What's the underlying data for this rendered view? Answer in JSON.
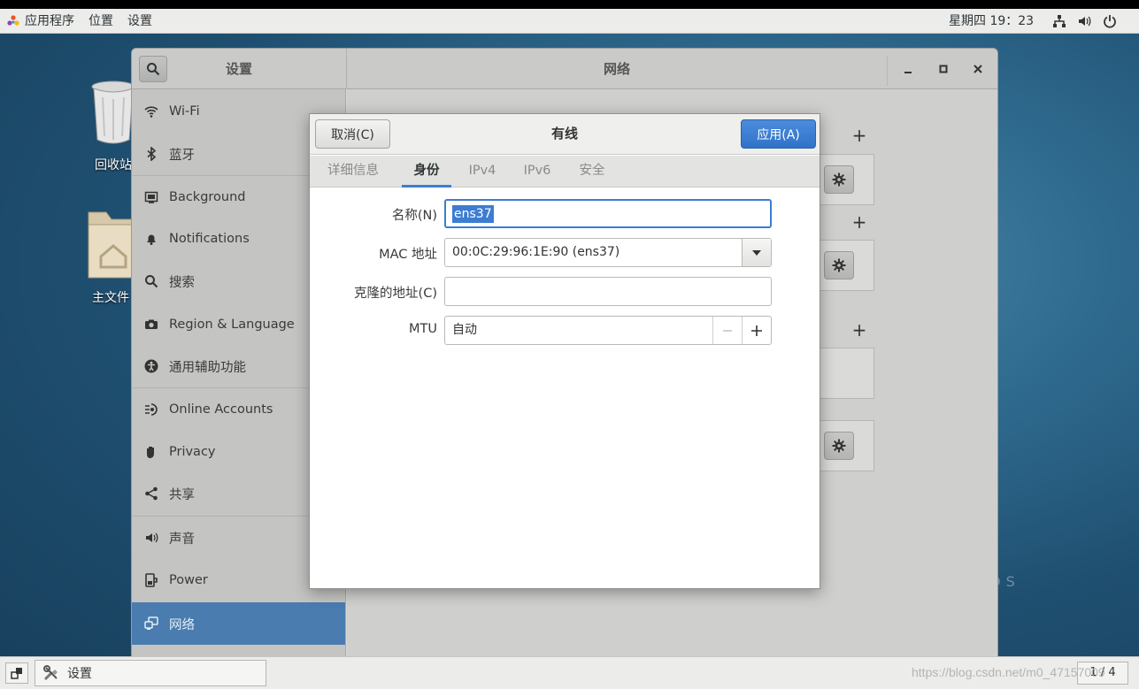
{
  "top_panel": {
    "menus": [
      "应用程序",
      "位置",
      "设置"
    ],
    "clock": "星期四 19：23",
    "tray": [
      "network-icon",
      "volume-icon",
      "power-icon"
    ]
  },
  "desktop": {
    "icons": [
      {
        "label": "回收站",
        "icon": "trash-icon"
      },
      {
        "label": "主文件",
        "icon": "home-folder-icon"
      }
    ],
    "brand_text": "OS"
  },
  "settings": {
    "sidebar_title": "设置",
    "main_title": "网络",
    "sidebar_items": [
      {
        "label": "Wi-Fi",
        "icon": "wifi-icon"
      },
      {
        "label": "蓝牙",
        "icon": "bluetooth-icon"
      },
      {
        "label": "Background",
        "icon": "background-icon"
      },
      {
        "label": "Notifications",
        "icon": "bell-icon"
      },
      {
        "label": "搜索",
        "icon": "search-icon"
      },
      {
        "label": "Region & Language",
        "icon": "camera-icon"
      },
      {
        "label": "通用辅助功能",
        "icon": "accessibility-icon"
      },
      {
        "label": "Online Accounts",
        "icon": "online-accounts-icon"
      },
      {
        "label": "Privacy",
        "icon": "hand-icon"
      },
      {
        "label": "共享",
        "icon": "share-icon"
      },
      {
        "label": "声音",
        "icon": "sound-icon"
      },
      {
        "label": "Power",
        "icon": "power-plug-icon"
      },
      {
        "label": "网络",
        "icon": "network-icon",
        "selected": true
      }
    ]
  },
  "dialog": {
    "title": "有线",
    "cancel_label": "取消(C)",
    "apply_label": "应用(A)",
    "tabs": [
      {
        "label": "详细信息"
      },
      {
        "label": "身份",
        "active": true
      },
      {
        "label": "IPv4"
      },
      {
        "label": "IPv6"
      },
      {
        "label": "安全"
      }
    ],
    "fields": {
      "name_label": "名称(N)",
      "name_value": "ens37",
      "mac_label": "MAC 地址",
      "mac_value": "00:0C:29:96:1E:90 (ens37)",
      "cloned_label": "克隆的地址(C)",
      "cloned_value": "",
      "mtu_label": "MTU",
      "mtu_value": "自动"
    }
  },
  "taskbar": {
    "task_label": "设置",
    "workspace": "1 / 4"
  },
  "watermark": "https://blog.csdn.net/m0_47157009",
  "colors": {
    "accent": "#3c7dd1",
    "selected_sidebar": "#4a7cb0",
    "panel": "#ececea"
  }
}
